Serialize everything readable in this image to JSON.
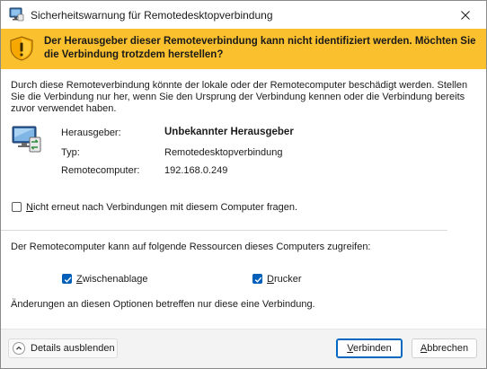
{
  "window": {
    "title": "Sicherheitswarnung für Remotedesktopverbindung"
  },
  "banner": {
    "text": "Der Herausgeber dieser Remoteverbindung kann nicht identifiziert werden. Möchten Sie die Verbindung trotzdem herstellen?"
  },
  "intro": {
    "text": "Durch diese Remoteverbindung könnte der lokale oder der Remotecomputer beschädigt werden. Stellen Sie die Verbindung nur her, wenn Sie den Ursprung der Verbindung kennen oder die Verbindung bereits zuvor verwendet haben."
  },
  "info": {
    "publisher_label": "Herausgeber:",
    "publisher_value": "Unbekannter Herausgeber",
    "type_label": "Typ:",
    "type_value": "Remotedesktopverbindung",
    "computer_label": "Remotecomputer:",
    "computer_value": "192.168.0.249"
  },
  "dont_ask": {
    "label_accesskey": "N",
    "label_rest": "icht erneut nach Verbindungen mit diesem Computer fragen.",
    "checked": false
  },
  "resources": {
    "heading": "Der Remotecomputer kann auf folgende Ressourcen dieses Computers zugreifen:",
    "clipboard_accesskey": "Z",
    "clipboard_rest": "wischenablage",
    "clipboard_checked": true,
    "printer_accesskey": "D",
    "printer_rest": "rucker",
    "printer_checked": true,
    "note": "Änderungen an diesen Optionen betreffen nur diese eine Verbindung."
  },
  "footer": {
    "details_label": "Details ausblenden",
    "connect_accesskey": "V",
    "connect_rest": "erbinden",
    "cancel_accesskey": "A",
    "cancel_rest": "bbrechen"
  },
  "colors": {
    "banner": "#fbc02d",
    "accent": "#005fb8"
  }
}
